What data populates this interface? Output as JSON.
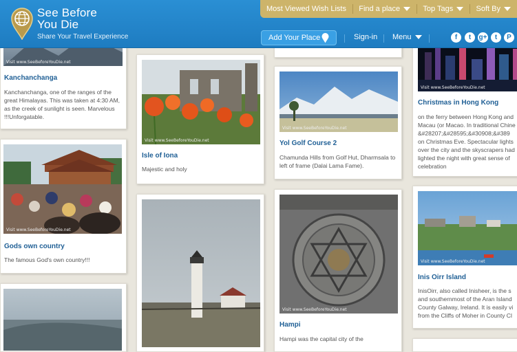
{
  "brand": {
    "title_line1": "See Before",
    "title_line2": "You Die",
    "tagline": "Share Your Travel Experience"
  },
  "topbar": {
    "most_viewed": "Most Viewed Wish Lists",
    "find_place": "Find a place",
    "top_tags": "Top Tags",
    "sort_by": "Soft By"
  },
  "nav": {
    "add_place": "Add Your Place",
    "signin": "Sign-in",
    "menu": "Menu"
  },
  "social": [
    "f",
    "t",
    "g+",
    "t",
    "P"
  ],
  "watermark": "Visit www.SeeBeforeYouDie.net",
  "cards": {
    "kanchanchanga": {
      "title": "Kanchanchanga",
      "desc": "Kanchanchanga, one of the ranges of the great Himalayas. This was taken at 4:30 AM, as the creek of sunlight is seen. Marvelous !!!Unforgatable."
    },
    "gods_own": {
      "title": "Gods own country",
      "desc": "The famous God's own country!!!"
    },
    "iona": {
      "title": "Isle of Iona",
      "desc": "Majestic and holy"
    },
    "yol": {
      "title": "Yol Golf Course 2",
      "desc": "Chamunda Hills from Golf Hut, Dharmsala to left of frame (Dalai Lama Fame)."
    },
    "hampi": {
      "title": "Hampi",
      "desc": "Hampi was the capital city of the"
    },
    "hongkong": {
      "title": "Christmas in Hong Kong",
      "desc_lines": [
        "on the ferry between Hong Kong and",
        "Macau (or Macao. In traditional Chine",
        "&#28207;&#28595;&#30908;&#389",
        "on Christmas Eve. Spectacular lights",
        "over the city and the skyscrapers had",
        "lighted the night with great sense of",
        "celebration"
      ]
    },
    "inis_oirr": {
      "title": "Inis Oirr Island",
      "desc_lines": [
        "InisOirr, also called Inisheer, is the s",
        "and southernmost of the Aran Island",
        "County Galway, Ireland. It is easily vi",
        "from the Cliffs of Moher in County Cl"
      ]
    }
  }
}
